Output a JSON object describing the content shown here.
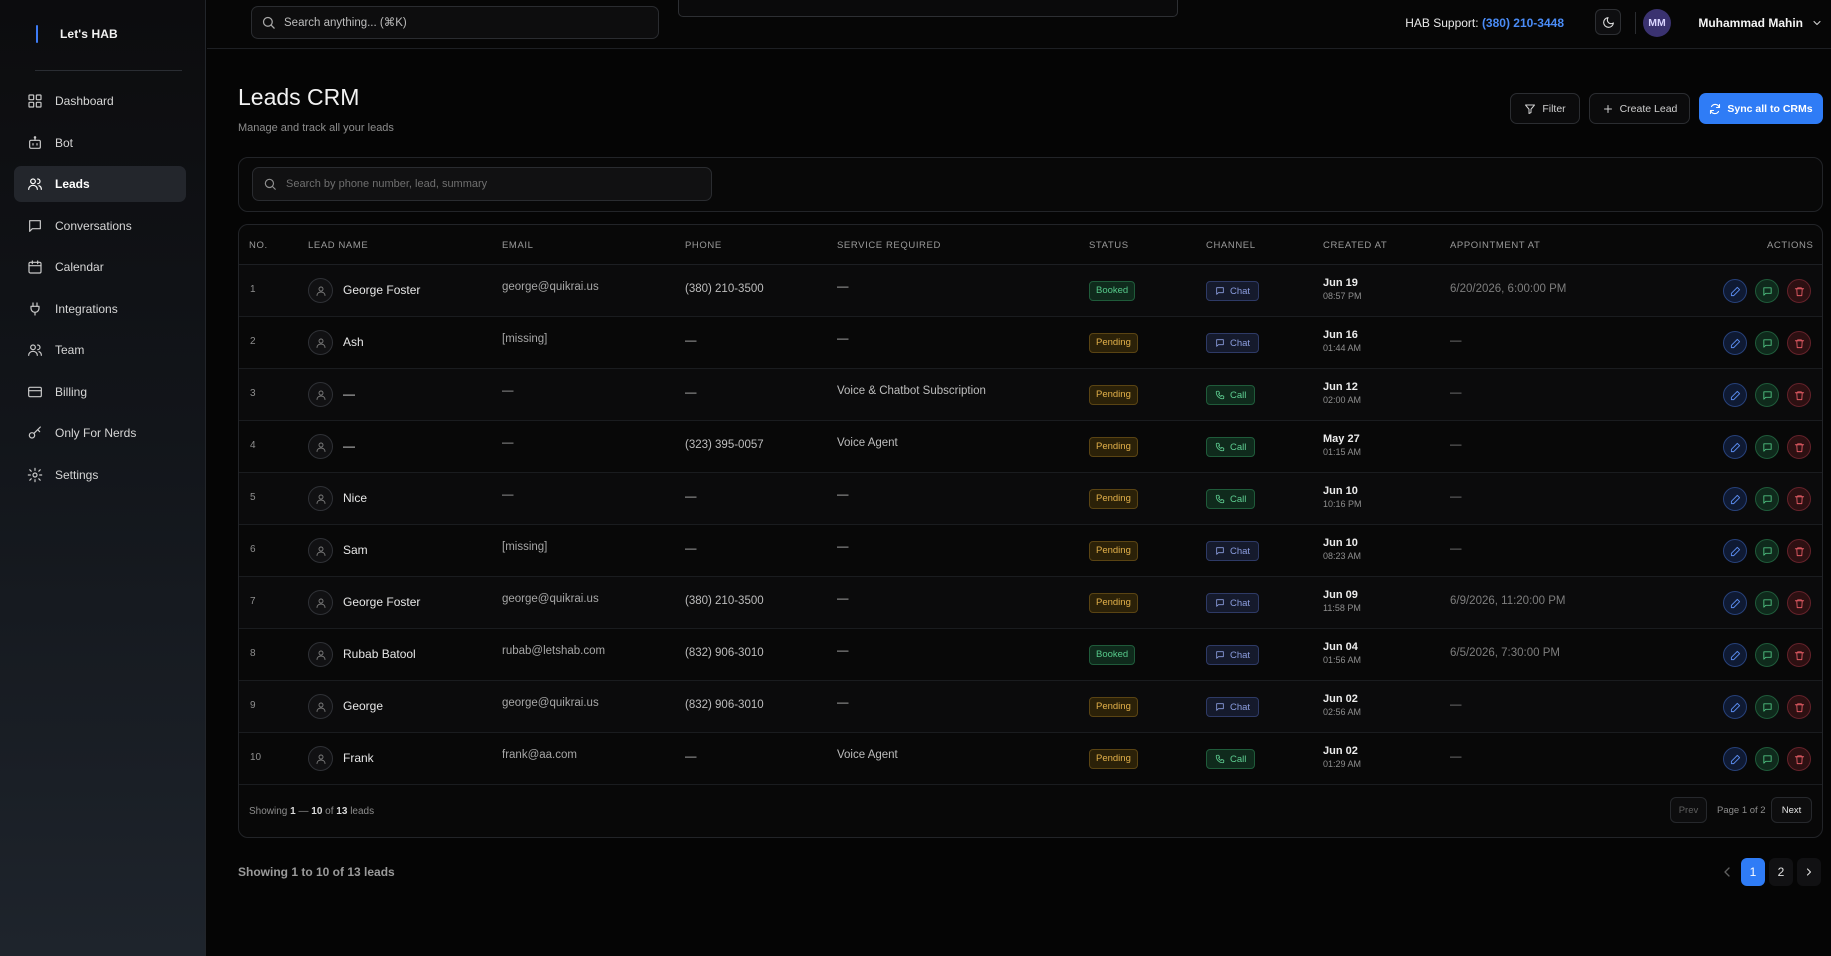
{
  "brand": {
    "name": "Let's HAB"
  },
  "sidebar": {
    "items": [
      {
        "label": "Dashboard",
        "icon": "dashboard-icon"
      },
      {
        "label": "Bot",
        "icon": "bot-icon"
      },
      {
        "label": "Leads",
        "icon": "users-icon",
        "active": true
      },
      {
        "label": "Conversations",
        "icon": "message-icon"
      },
      {
        "label": "Calendar",
        "icon": "calendar-icon"
      },
      {
        "label": "Integrations",
        "icon": "plug-icon"
      },
      {
        "label": "Team",
        "icon": "team-icon"
      },
      {
        "label": "Billing",
        "icon": "credit-card-icon"
      },
      {
        "label": "Only For Nerds",
        "icon": "key-icon"
      },
      {
        "label": "Settings",
        "icon": "gear-icon"
      }
    ]
  },
  "topbar": {
    "search_placeholder": "Search anything... (⌘K)",
    "support_label": "HAB Support:",
    "support_phone": "(380) 210-3448",
    "user_initials": "MM",
    "user_name": "Muhammad Mahin"
  },
  "page": {
    "title": "Leads CRM",
    "subtitle": "Manage and track all your leads",
    "filter_label": "Filter",
    "create_label": "Create Lead",
    "sync_label": "Sync all to CRMs",
    "search_placeholder": "Search by phone number, lead, summary"
  },
  "table": {
    "headers": {
      "no": "NO.",
      "name": "LEAD NAME",
      "email": "EMAIL",
      "phone": "PHONE",
      "service": "SERVICE REQUIRED",
      "status": "STATUS",
      "channel": "CHANNEL",
      "created": "CREATED AT",
      "appointment": "APPOINTMENT AT",
      "actions": "ACTIONS"
    },
    "rows": [
      {
        "no": "1",
        "name": "George Foster",
        "email": "george@quikrai.us",
        "phone": "(380) 210-3500",
        "service": "—",
        "status": "Booked",
        "channel": "Chat",
        "created_date": "Jun 19",
        "created_time": "08:57 PM",
        "appointment": "6/20/2026, 6:00:00 PM"
      },
      {
        "no": "2",
        "name": "Ash",
        "email": "[missing]",
        "phone": "—",
        "service": "—",
        "status": "Pending",
        "channel": "Chat",
        "created_date": "Jun 16",
        "created_time": "01:44 AM",
        "appointment": "—"
      },
      {
        "no": "3",
        "name": "—",
        "email": "—",
        "phone": "—",
        "service": "Voice & Chatbot Subscription",
        "status": "Pending",
        "channel": "Call",
        "created_date": "Jun 12",
        "created_time": "02:00 AM",
        "appointment": "—"
      },
      {
        "no": "4",
        "name": "—",
        "email": "—",
        "phone": "(323) 395-0057",
        "service": "Voice Agent",
        "status": "Pending",
        "channel": "Call",
        "created_date": "May 27",
        "created_time": "01:15 AM",
        "appointment": "—"
      },
      {
        "no": "5",
        "name": "Nice",
        "email": "—",
        "phone": "—",
        "service": "—",
        "status": "Pending",
        "channel": "Call",
        "created_date": "Jun 10",
        "created_time": "10:16 PM",
        "appointment": "—"
      },
      {
        "no": "6",
        "name": "Sam",
        "email": "[missing]",
        "phone": "—",
        "service": "—",
        "status": "Pending",
        "channel": "Chat",
        "created_date": "Jun 10",
        "created_time": "08:23 AM",
        "appointment": "—"
      },
      {
        "no": "7",
        "name": "George Foster",
        "email": "george@quikrai.us",
        "phone": "(380) 210-3500",
        "service": "—",
        "status": "Pending",
        "channel": "Chat",
        "created_date": "Jun 09",
        "created_time": "11:58 PM",
        "appointment": "6/9/2026, 11:20:00 PM"
      },
      {
        "no": "8",
        "name": "Rubab Batool",
        "email": "rubab@letshab.com",
        "phone": "(832) 906-3010",
        "service": "—",
        "status": "Booked",
        "channel": "Chat",
        "created_date": "Jun 04",
        "created_time": "01:56 AM",
        "appointment": "6/5/2026, 7:30:00 PM"
      },
      {
        "no": "9",
        "name": "George",
        "email": "george@quikrai.us",
        "phone": "(832) 906-3010",
        "service": "—",
        "status": "Pending",
        "channel": "Chat",
        "created_date": "Jun 02",
        "created_time": "02:56 AM",
        "appointment": "—"
      },
      {
        "no": "10",
        "name": "Frank",
        "email": "frank@aa.com",
        "phone": "—",
        "service": "Voice Agent",
        "status": "Pending",
        "channel": "Call",
        "created_date": "Jun 02",
        "created_time": "01:29 AM",
        "appointment": "—"
      }
    ],
    "footer": {
      "showing_prefix": "Showing",
      "range_start": "1",
      "range_sep": "—",
      "range_end": "10",
      "of_text": "of",
      "total": "13",
      "suffix": "leads",
      "prev_label": "Prev",
      "page_info": "Page 1 of 2",
      "next_label": "Next"
    }
  },
  "bottom": {
    "showing_text": "Showing 1 to 10 of 13 leads",
    "pages": [
      "1",
      "2"
    ],
    "current_page": "1"
  },
  "colors": {
    "accent": "#2f7cf6",
    "booked": "#56c98a",
    "pending": "#e3b14a",
    "danger": "#e05a63"
  }
}
